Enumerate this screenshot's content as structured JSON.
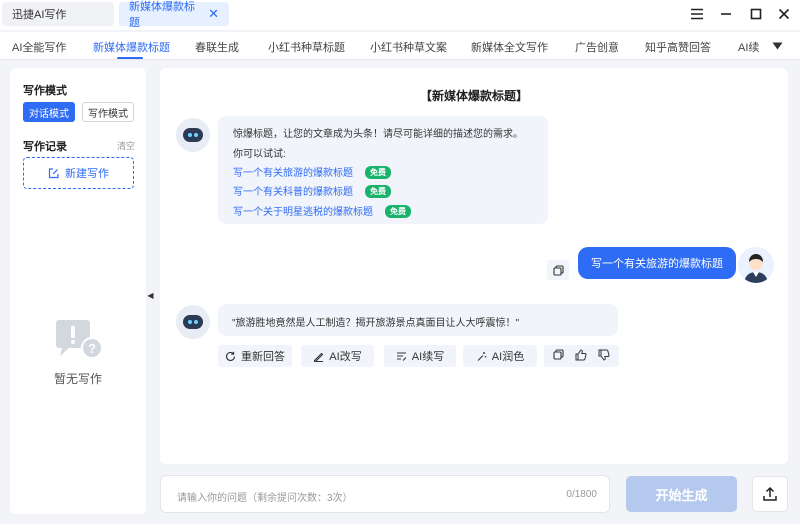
{
  "window": {
    "tabs": [
      {
        "label": "迅捷AI写作"
      },
      {
        "label": "新媒体爆款标题",
        "close": "✕"
      }
    ]
  },
  "nav": {
    "items": [
      {
        "label": "AI全能写作"
      },
      {
        "label": "新媒体爆款标题"
      },
      {
        "label": "春联生成"
      },
      {
        "label": "小红书种草标题"
      },
      {
        "label": "小红书种草文案"
      },
      {
        "label": "新媒体全文写作"
      },
      {
        "label": "广告创意"
      },
      {
        "label": "知乎高赞回答"
      },
      {
        "label": "AI续"
      }
    ],
    "active_index": 1
  },
  "sidebar": {
    "mode_title": "写作模式",
    "mode_chat": "对话模式",
    "mode_write": "写作模式",
    "record_title": "写作记录",
    "clear": "清空",
    "new_button": "新建写作",
    "empty_text": "暂无写作"
  },
  "chat": {
    "title": "【新媒体爆款标题】",
    "intro_line1": "惊爆标题，让您的文章成为头条！请尽可能详细的描述您的需求。",
    "intro_line2": "你可以试试:",
    "suggestions": [
      {
        "text": "写一个有关旅游的爆款标题",
        "badge": "免费"
      },
      {
        "text": "写一个有关科普的爆款标题",
        "badge": "免费"
      },
      {
        "text": "写一个关于明星逃税的爆款标题",
        "badge": "免费"
      }
    ],
    "user_message": "写一个有关旅游的爆款标题",
    "answer": "\"旅游胜地竟然是人工制造？揭开旅游景点真面目让人大呼震惊！\"",
    "actions": {
      "regenerate": "重新回答",
      "rewrite": "AI改写",
      "continue": "AI续写",
      "polish": "AI润色"
    }
  },
  "composer": {
    "placeholder": "请输入你的问题（剩余提问次数：3次）",
    "counter": "0/1800",
    "submit": "开始生成"
  },
  "colors": {
    "accent": "#2f6cf6",
    "free_badge": "#19b36b",
    "disabled_button": "#b5c9ee"
  }
}
